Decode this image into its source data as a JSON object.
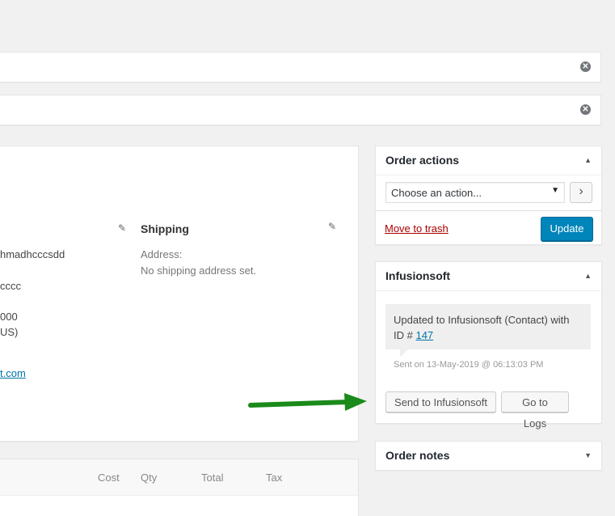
{
  "notices": [
    {
      "dismiss_glyph": "✕"
    },
    {
      "dismiss_glyph": "✕"
    }
  ],
  "order_details": {
    "billing_fragments": [
      "hmadhcccsdd",
      "cccc",
      "000",
      "US)"
    ],
    "billing_email_fragment": "t.com",
    "shipping": {
      "title": "Shipping",
      "address_label": "Address:",
      "address_value": "No shipping address set."
    }
  },
  "items_table": {
    "columns": [
      "Cost",
      "Qty",
      "Total",
      "Tax"
    ]
  },
  "order_actions": {
    "title": "Order actions",
    "select_value": "Choose an action...",
    "go_glyph": "›",
    "trash_label": "Move to trash",
    "update_label": "Update"
  },
  "infusionsoft": {
    "title": "Infusionsoft",
    "message_text": "Updated to Infusionsoft (Contact) with ID # ",
    "contact_id": "147",
    "sent_meta": "Sent on 13-May-2019 @ 06:13:03 PM",
    "send_label": "Send to Infusionsoft",
    "logs_label": "Go to Logs"
  },
  "order_notes": {
    "title": "Order notes"
  },
  "colors": {
    "arrow": "#1a8a1a",
    "primary": "#0085ba",
    "link": "#0073aa"
  }
}
